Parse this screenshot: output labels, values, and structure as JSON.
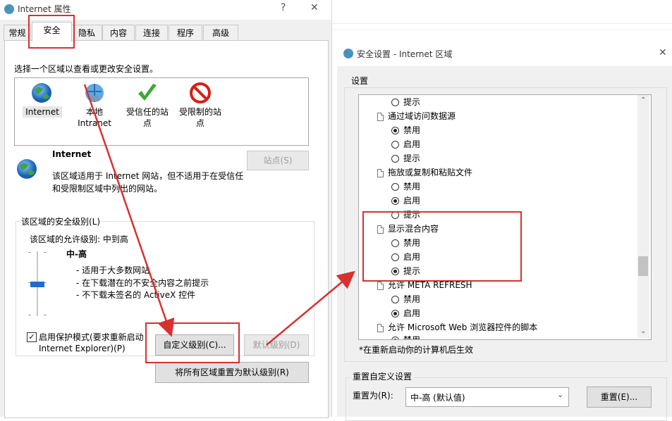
{
  "dialog1": {
    "title": "Internet 属性",
    "help": "?",
    "close": "✕",
    "tabs": [
      "常规",
      "安全",
      "隐私",
      "内容",
      "连接",
      "程序",
      "高级"
    ],
    "zone_prompt": "选择一个区域以查看或更改安全设置。",
    "zones": [
      {
        "label": "Internet"
      },
      {
        "label_l1": "本地",
        "label_l2": "Intranet"
      },
      {
        "label_l1": "受信任的站",
        "label_l2": "点"
      },
      {
        "label_l1": "受限制的站",
        "label_l2": "点"
      }
    ],
    "selected_zone_title": "Internet",
    "selected_zone_desc_l1": "该区域适用于 Internet 网站，但不适用于在受信任",
    "selected_zone_desc_l2": "和受限制区域中列出的网站。",
    "sites_button": "站点(S)",
    "level_group_title": "该区域的安全级别(L)",
    "allowed_levels": "该区域的允许级别: 中到高",
    "level_name": "中-高",
    "level_bullets": [
      "- 适用于大多数网站",
      "- 在下载潜在的不安全内容之前提示",
      "- 不下载未签名的 ActiveX 控件"
    ],
    "protected_mode_l1": "启用保护模式(要求重新启动",
    "protected_mode_l2": "Internet Explorer)(P)",
    "custom_level_button": "自定义级别(C)...",
    "default_level_button": "默认级别(D)",
    "reset_all_button": "将所有区域重置为默认级别(R)"
  },
  "dialog2": {
    "title": "安全设置 - Internet 区域",
    "close": "✕",
    "settings_label": "设置",
    "items": [
      {
        "type": "radio",
        "label": "提示",
        "checked": false
      },
      {
        "type": "item",
        "label": "通过域访问数据源"
      },
      {
        "type": "radio",
        "label": "禁用",
        "checked": true
      },
      {
        "type": "radio",
        "label": "启用",
        "checked": false
      },
      {
        "type": "radio",
        "label": "提示",
        "checked": false
      },
      {
        "type": "item",
        "label": "拖放或复制和粘贴文件"
      },
      {
        "type": "radio",
        "label": "禁用",
        "checked": false
      },
      {
        "type": "radio",
        "label": "启用",
        "checked": true
      },
      {
        "type": "radio",
        "label": "提示",
        "checked": false
      },
      {
        "type": "item",
        "label": "显示混合内容"
      },
      {
        "type": "radio",
        "label": "禁用",
        "checked": false
      },
      {
        "type": "radio",
        "label": "启用",
        "checked": false
      },
      {
        "type": "radio",
        "label": "提示",
        "checked": true
      },
      {
        "type": "item",
        "label": "允许 META REFRESH"
      },
      {
        "type": "radio",
        "label": "禁用",
        "checked": false
      },
      {
        "type": "radio",
        "label": "启用",
        "checked": true
      },
      {
        "type": "item",
        "label": "允许 Microsoft Web 浏览器控件的脚本"
      },
      {
        "type": "radio",
        "label": "禁用",
        "checked": true
      }
    ],
    "restart_note": "*在重新启动你的计算机后生效",
    "reset_group_title": "重置自定义设置",
    "reset_to_label": "重置为(R):",
    "reset_to_value": "中-高 (默认值)",
    "reset_button": "重置(E)..."
  },
  "colors": {
    "annotation": "#d93030",
    "slider_thumb": "#1e6fc8",
    "check_green": "#3aa935",
    "block_red": "#d91e18"
  }
}
